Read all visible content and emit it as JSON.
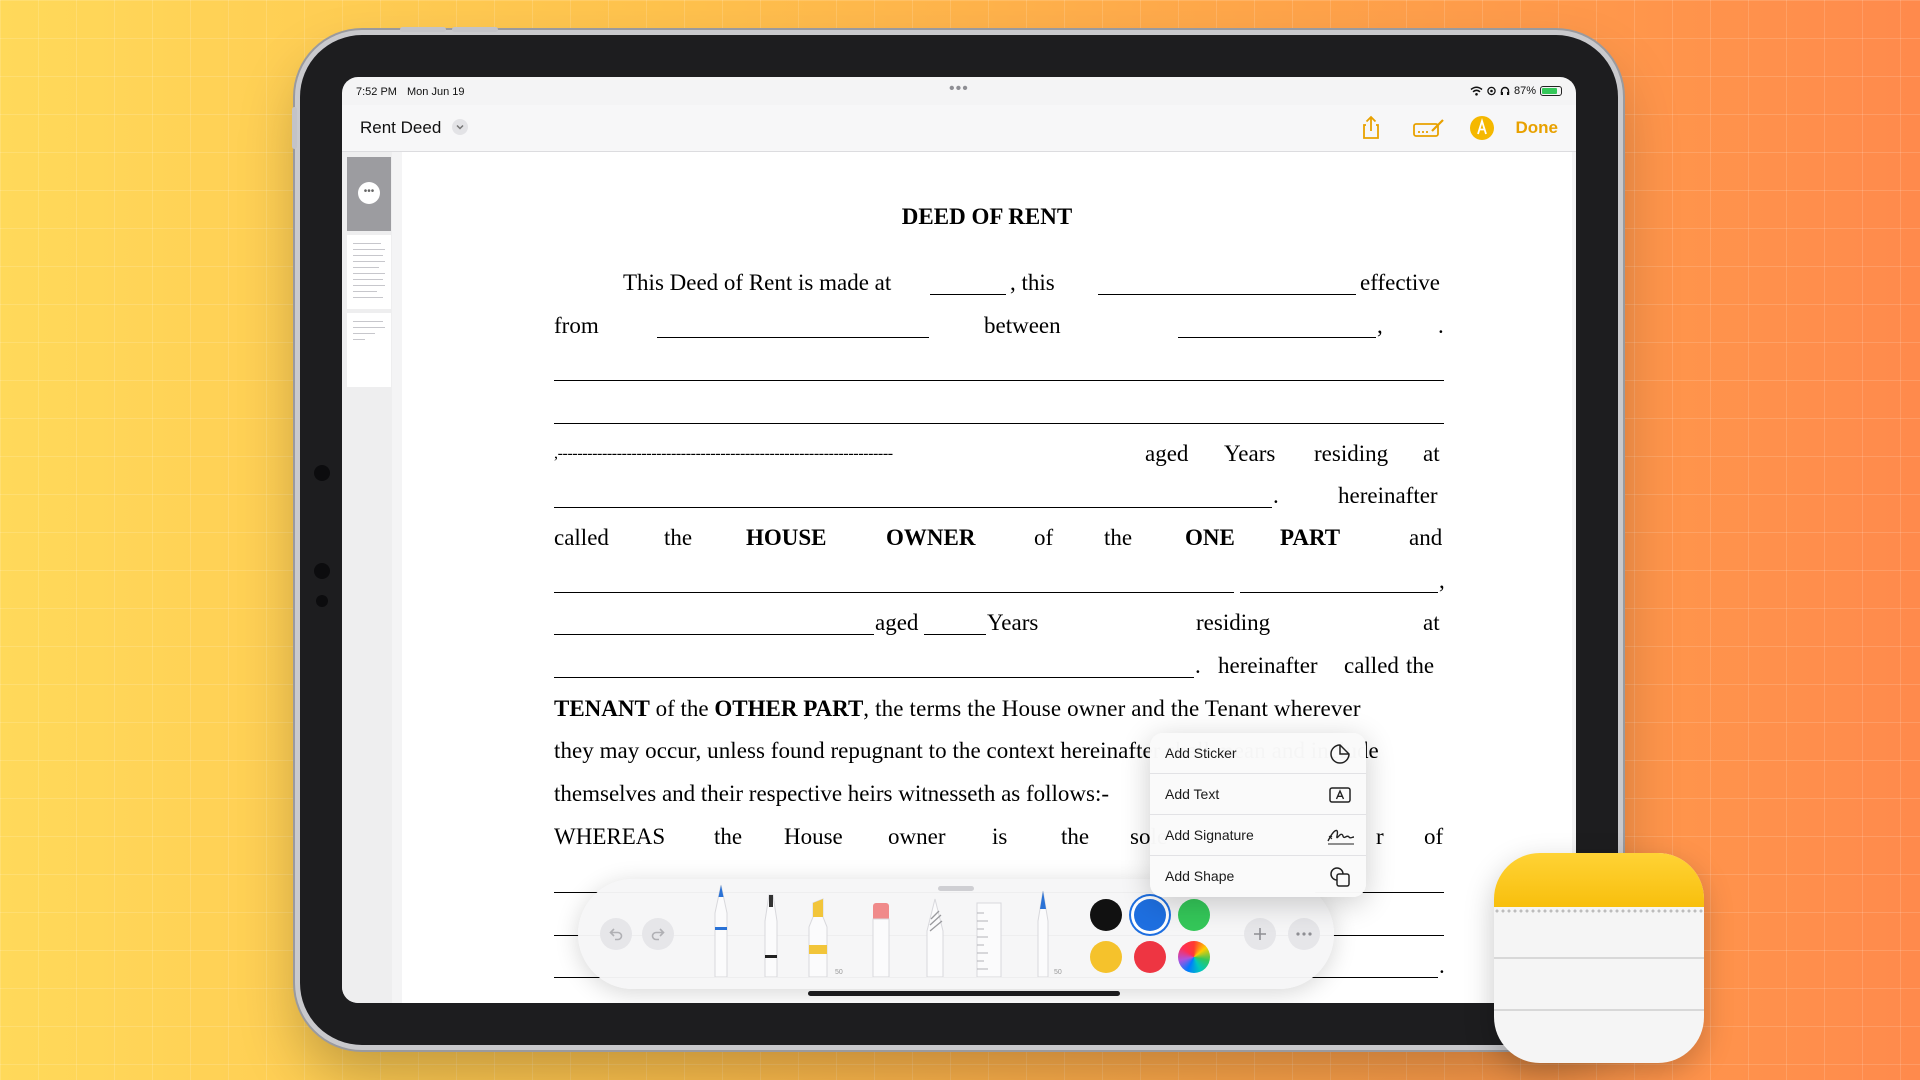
{
  "status_bar": {
    "time": "7:52 PM",
    "date": "Mon Jun 19",
    "battery": "87%",
    "battery_level": 0.87
  },
  "navbar": {
    "title": "Rent Deed",
    "done_label": "Done"
  },
  "document": {
    "title": "DEED OF RENT",
    "l1_a": "This Deed of Rent is made at",
    "l1_b": ", this",
    "l1_c": "effective",
    "l2_a": "from",
    "l2_b": "between",
    "l2_c": ",",
    "l2_d": ".",
    "l5_a": ",--------------------------------------------------------------------",
    "l5_b": "aged",
    "l5_c": "Years",
    "l5_d": "residing",
    "l5_e": "at",
    "l6_a": ".",
    "l6_b": "hereinafter",
    "l7": [
      "called",
      "the",
      "HOUSE",
      "OWNER",
      "of",
      "the",
      "ONE",
      "PART",
      "and"
    ],
    "l8_a": ",",
    "l9_a": "aged",
    "l9_b": "Years",
    "l9_c": "residing",
    "l9_d": "at",
    "l10_a": ".",
    "l10_b": "hereinafter",
    "l10_c": "called",
    "l10_d": "the",
    "l11_a": "TENANT",
    "l11_b": " of the ",
    "l11_c": "OTHER PART",
    "l11_d": ", the terms the House owner and the Tenant wherever",
    "l12": "they may occur, unless found repugnant to the context hereinafter shall mean and include",
    "l13": "themselves and their respective heirs witnesseth as follows:-",
    "l14": [
      "WHEREAS",
      "the",
      "House",
      "owner",
      "is",
      "the",
      "sole",
      "r",
      "of"
    ],
    "l17_a": "."
  },
  "palette": {
    "colors": [
      "#111111",
      "#1e6fe0",
      "#34c759",
      "#f5c22c",
      "#ee3542"
    ],
    "selected_color": "#1e6fe0",
    "pen_size_label": "50",
    "marker_size_label": "50",
    "fountain_size_label": "50"
  },
  "menu": {
    "items": [
      {
        "label": "Add Sticker",
        "icon": "sticker-icon"
      },
      {
        "label": "Add Text",
        "icon": "text-box-icon"
      },
      {
        "label": "Add Signature",
        "icon": "signature-icon"
      },
      {
        "label": "Add Shape",
        "icon": "shapes-icon"
      }
    ]
  },
  "accent_color": "#e8a100"
}
